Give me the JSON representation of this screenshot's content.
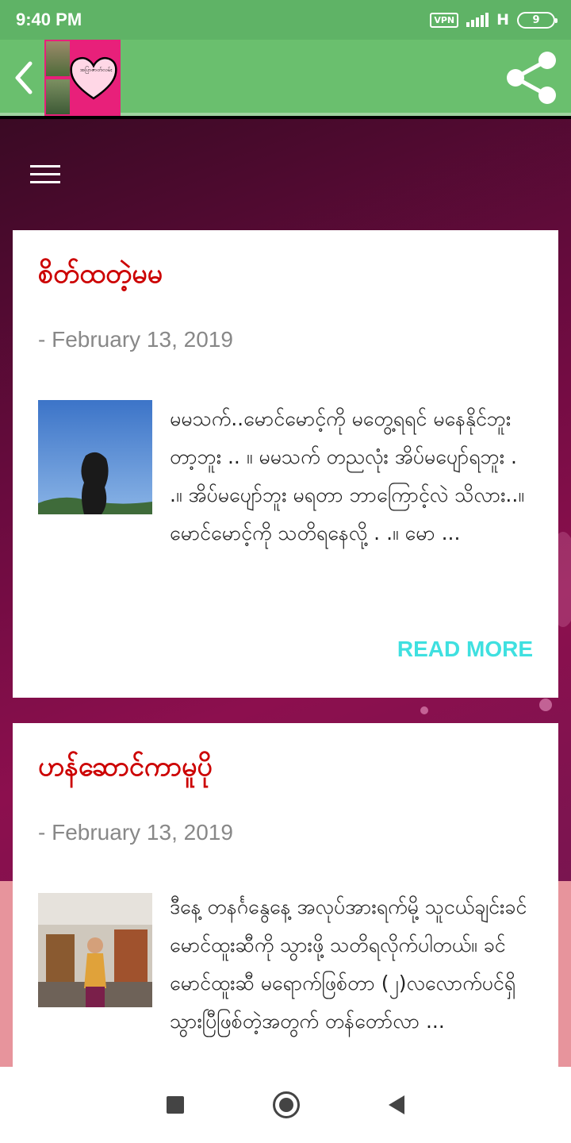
{
  "status_bar": {
    "time": "9:40 PM",
    "vpn": "VPN",
    "network": "H",
    "battery": "9"
  },
  "app_bar": {
    "logo_text": "အပြာ​ဇာတ်လမ်း",
    "colors": {
      "background": "#6abf6e",
      "logo_bg": "#e8207a"
    }
  },
  "posts": [
    {
      "title": "စိတ်ထတဲ့မမ",
      "date": "- February 13, 2019",
      "excerpt": "မမသက်..မောင်မောင့်ကို မတွေ့ရရင် မနေနိုင်ဘူး တာ့ဘူး .. ။ မမသက် တညလုံး အိပ်မပျော်ရဘူး . .။ အိပ်မပျော်ဘူး မရတာ ဘာကြောင့်လဲ သိလား..။ မောင်မောင့်ကို သတိရနေလို့ . .။ မော ...",
      "read_more": "READ MORE"
    },
    {
      "title": "ဟန်ဆောင်ကာမူပို",
      "date": "- February 13, 2019",
      "excerpt": "ဒီနေ့ တနင်္ဂနွေနေ့ အလုပ်အားရက်မို့ သူငယ်ချင်းခင်မောင်ထူးဆီကို သွားဖို့ သတိရလိုက်ပါတယ်။ ခင်မောင်ထူးဆီ မရောက်ဖြစ်တာ (၂)လလောက်ပင်ရှိ သွားပြီဖြစ်တဲ့အတွက် တန်တော်လာ ..."
    }
  ],
  "colors": {
    "title": "#cc0000",
    "read_more": "#3fe0e0",
    "date": "#888888"
  }
}
